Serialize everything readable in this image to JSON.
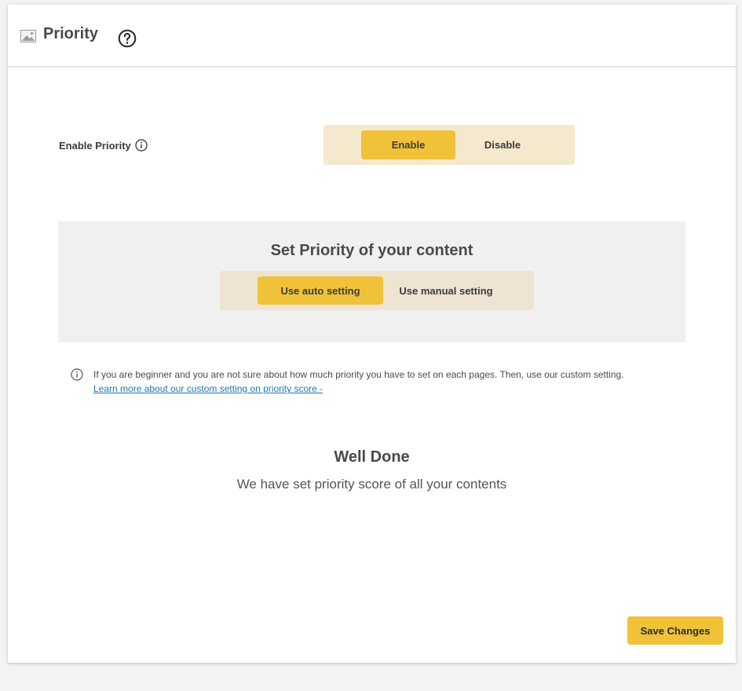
{
  "header": {
    "title": "Priority",
    "icons": [
      "image-icon",
      "help-circle-icon"
    ]
  },
  "enable_priority": {
    "label": "Enable Priority",
    "options": [
      "Enable",
      "Disable"
    ],
    "selected": "Enable"
  },
  "priority_setting": {
    "title": "Set Priority of your content",
    "options": [
      "Use auto setting",
      "Use manual setting"
    ],
    "selected": "Use auto setting"
  },
  "info": {
    "text": "If you are beginner and you are not sure about how much priority you have to set on each pages. Then, use our custom setting.",
    "link": "Learn more about our custom setting on priority score -"
  },
  "done": {
    "title": "Well Done",
    "subtitle": "We have set priority score of all your contents"
  },
  "footer": {
    "save_label": "Save Changes"
  },
  "colors": {
    "accent": "#f0c239",
    "segment_bg": "#f5e9cd",
    "panel_bg": "#f0f0f0",
    "link": "#1b7bb5"
  }
}
